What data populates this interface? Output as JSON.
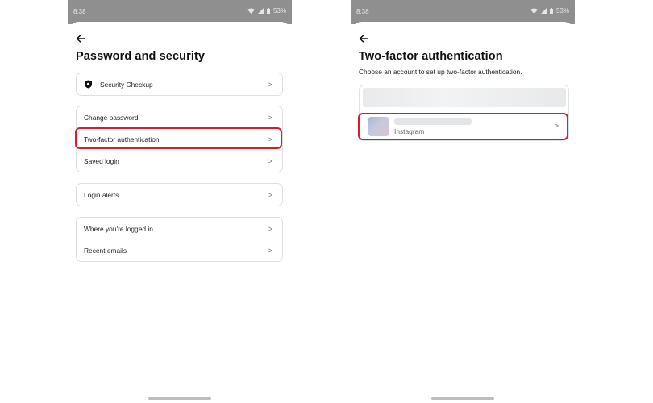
{
  "status_bar": {
    "time": "8:38",
    "battery": "53%"
  },
  "left_screen": {
    "title": "Password and security",
    "groups": [
      {
        "items": [
          {
            "label": "Security Checkup",
            "icon": "shield-icon"
          }
        ]
      },
      {
        "items": [
          {
            "label": "Change password"
          },
          {
            "label": "Two-factor authentication",
            "highlighted": true
          },
          {
            "label": "Saved login"
          }
        ]
      },
      {
        "items": [
          {
            "label": "Login alerts"
          }
        ]
      },
      {
        "items": [
          {
            "label": "Where you're logged in"
          },
          {
            "label": "Recent emails"
          }
        ]
      }
    ],
    "chevron": ">"
  },
  "right_screen": {
    "title": "Two-factor authentication",
    "subtitle": "Choose an account to set up two-factor authentication.",
    "account": {
      "type": "Instagram",
      "highlighted": true
    },
    "chevron": ">"
  },
  "colors": {
    "highlight": "#d91c2a",
    "status_bar": "#8f8f8f",
    "border": "#dcdfe3",
    "text": "#1c1e21"
  }
}
